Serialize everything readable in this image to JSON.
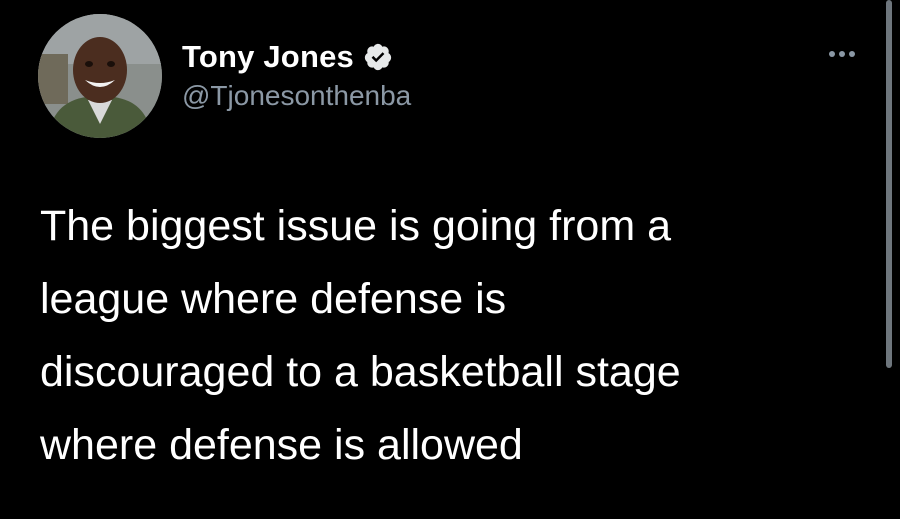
{
  "author": {
    "display_name": "Tony Jones",
    "handle": "@Tjonesonthenba",
    "verified": true,
    "avatar_icon": "profile-photo"
  },
  "tweet": {
    "text_lines": [
      "The biggest issue is going from a",
      "league where defense is",
      "discouraged to a basketball stage",
      "where defense is allowed"
    ]
  },
  "colors": {
    "background": "#000000",
    "text_primary": "#ffffff",
    "text_secondary": "#8b98a5",
    "verified_badge": "#e7e9ea"
  },
  "icons": {
    "more": "more-options-icon",
    "verified": "verified-badge-icon"
  }
}
